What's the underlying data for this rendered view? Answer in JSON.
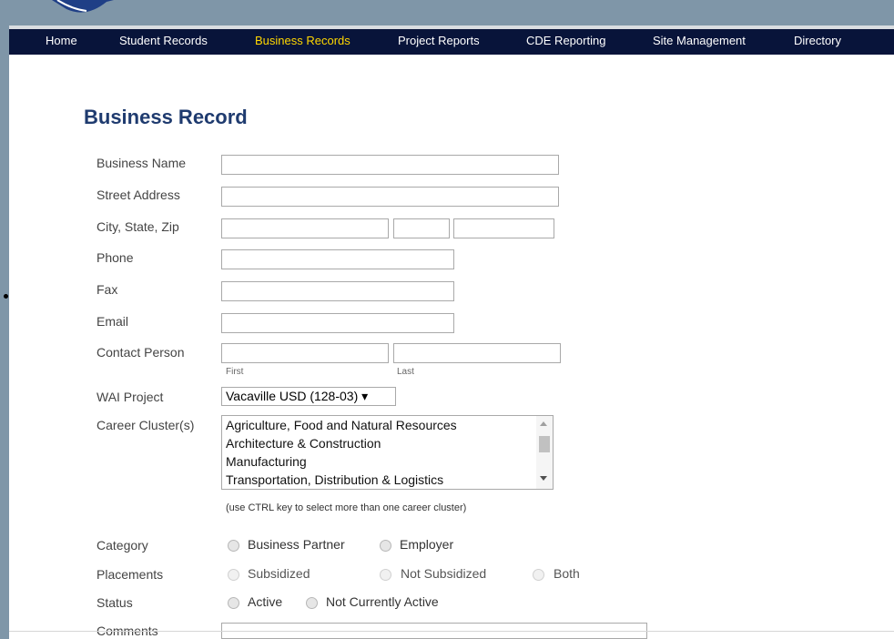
{
  "nav": {
    "items": [
      "Home",
      "Student Records",
      "Business Records",
      "Project Reports",
      "CDE Reporting",
      "Site Management",
      "Directory"
    ],
    "active_index": 2
  },
  "page_title": "Business Record",
  "form": {
    "business_name_label": "Business Name",
    "street_address_label": "Street Address",
    "city_state_zip_label": "City, State, Zip",
    "phone_label": "Phone",
    "fax_label": "Fax",
    "email_label": "Email",
    "contact_person_label": "Contact Person",
    "contact_first_label": "First",
    "contact_last_label": "Last",
    "wai_project_label": "WAI Project",
    "wai_project_value": "Vacaville USD (128-03) ▾",
    "career_cluster_label": "Career Cluster(s)",
    "career_cluster_options": [
      "Agriculture, Food and Natural Resources",
      "Architecture & Construction",
      "Manufacturing",
      "Transportation, Distribution & Logistics"
    ],
    "career_cluster_hint": "(use CTRL key to select more than one career cluster)",
    "category_label": "Category",
    "category_options": [
      "Business Partner",
      "Employer"
    ],
    "placements_label": "Placements",
    "placements_options": [
      "Subsidized",
      "Not Subsidized",
      "Both"
    ],
    "status_label": "Status",
    "status_options": [
      "Active",
      "Not Currently Active"
    ],
    "comments_label": "Comments"
  },
  "colors": {
    "nav_bg": "#08143a",
    "nav_active": "#ffd700",
    "title": "#1f3b6f",
    "frame": "#7f96a8"
  },
  "icons": {
    "logo": "logo-mark",
    "bullet": "bullet-dot"
  }
}
